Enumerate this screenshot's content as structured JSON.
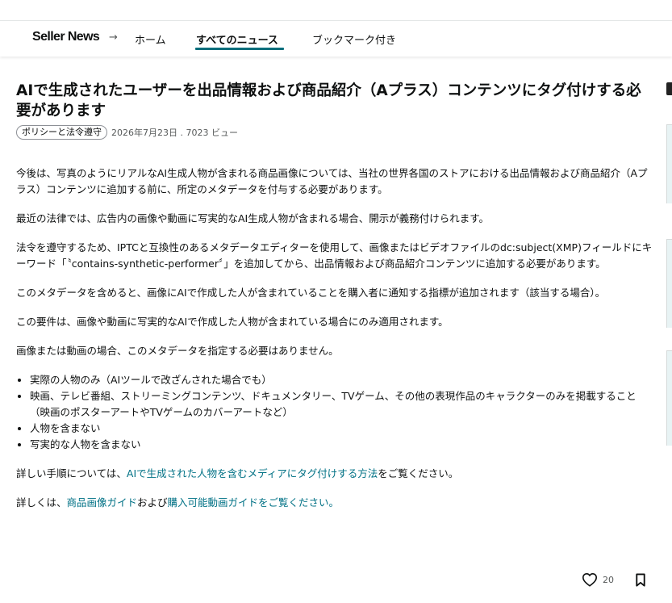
{
  "nav": {
    "brand": "Seller News",
    "arrow": "→",
    "links": [
      "ホーム",
      "すべてのニュース",
      "ブックマーク付き"
    ]
  },
  "article": {
    "title": "AIで生成されたユーザーを出品情報および商品紹介（Aプラス）コンテンツにタグ付けする必要があります",
    "category": "ポリシーと法令遵守",
    "date_views": "2026年7月23日 . 7023 ビュー",
    "paragraphs": [
      "今後は、写真のようにリアルなAI生成人物が含まれる商品画像については、当社の世界各国のストアにおける出品情報および商品紹介（Aプラス）コンテンツに追加する前に、所定のメタデータを付与する必要があります。",
      "最近の法律では、広告内の画像や動画に写実的なAI生成人物が含まれる場合、開示が義務付けられます。",
      "法令を遵守するため、IPTCと互換性のあるメタデータエディターを使用して、画像またはビデオファイルのdc:subject(XMP)フィールドにキーワード「〝contains-synthetic-performer〞」を追加してから、出品情報および商品紹介コンテンツに追加する必要があります。",
      "このメタデータを含めると、画像にAIで作成した人が含まれていることを購入者に通知する指標が追加されます（該当する場合）。",
      "この要件は、画像や動画に写実的なAIで作成した人物が含まれている場合にのみ適用されます。",
      "画像または動画の場合、このメタデータを指定する必要はありません。"
    ],
    "bullets": [
      "実際の人物のみ（AIツールで改ざんされた場合でも）",
      "映画、テレビ番組、ストリーミングコンテンツ、ドキュメンタリー、TVゲーム、その他の表現作品のキャラクターのみを掲載すること（映画のポスターアートやTVゲームのカバーアートなど）",
      "人物を含まない",
      "写実的な人物を含まない"
    ],
    "steps_prefix": "詳しい手順については、",
    "steps_link": "AIで生成された人物を含むメディアにタグ付けする方法",
    "steps_suffix": "をご覧ください。",
    "more_prefix": "詳しくは、",
    "more_link1": "商品画像ガイド",
    "more_middle": "および",
    "more_link2": "購入可能動画ガイドをご覧ください。"
  },
  "actions": {
    "like_count": "20",
    "like_icon": "heart-icon",
    "bookmark_icon": "bookmark-icon"
  },
  "colors": {
    "accent": "#006e7c",
    "link": "#007185",
    "text": "#0f1111",
    "muted": "#565959"
  }
}
